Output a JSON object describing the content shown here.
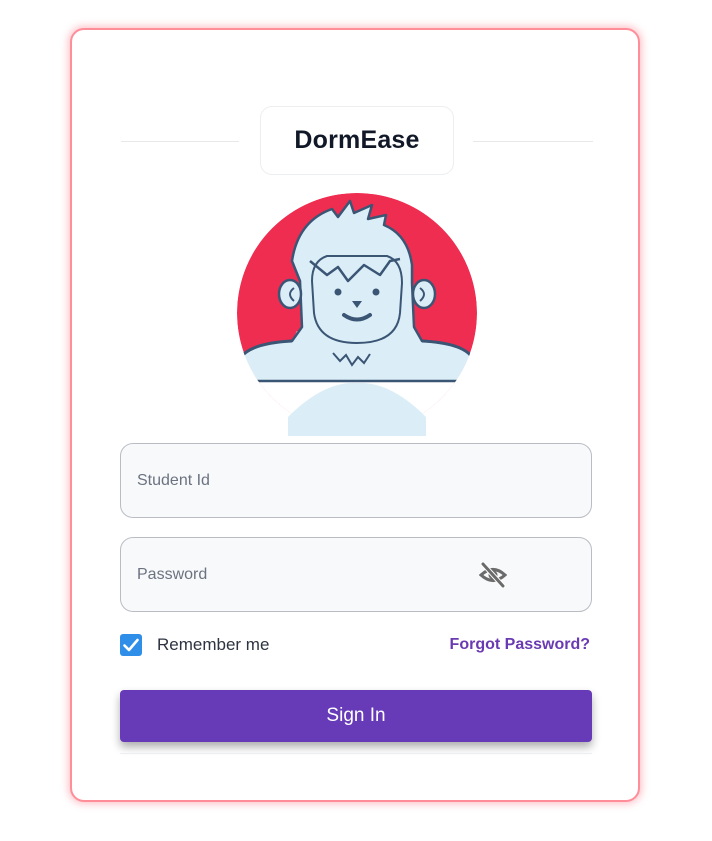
{
  "brand": {
    "title": "DormEase"
  },
  "avatar": {
    "icon": "yeti-mascot-icon",
    "bg_color": "#ee2d51",
    "fur_color": "#dbeef8",
    "line_color": "#3b5675"
  },
  "form": {
    "student_id": {
      "placeholder": "Student Id",
      "value": ""
    },
    "password": {
      "placeholder": "Password",
      "value": "",
      "toggle_icon": "eye-off-icon"
    },
    "remember": {
      "label": "Remember me",
      "checked": true
    },
    "forgot_link": "Forgot Password?",
    "submit_label": "Sign In"
  },
  "colors": {
    "accent": "#673ab7",
    "card_glow": "#ff8e99",
    "checkbox": "#2f8fe8",
    "link": "#6a3ab2"
  }
}
